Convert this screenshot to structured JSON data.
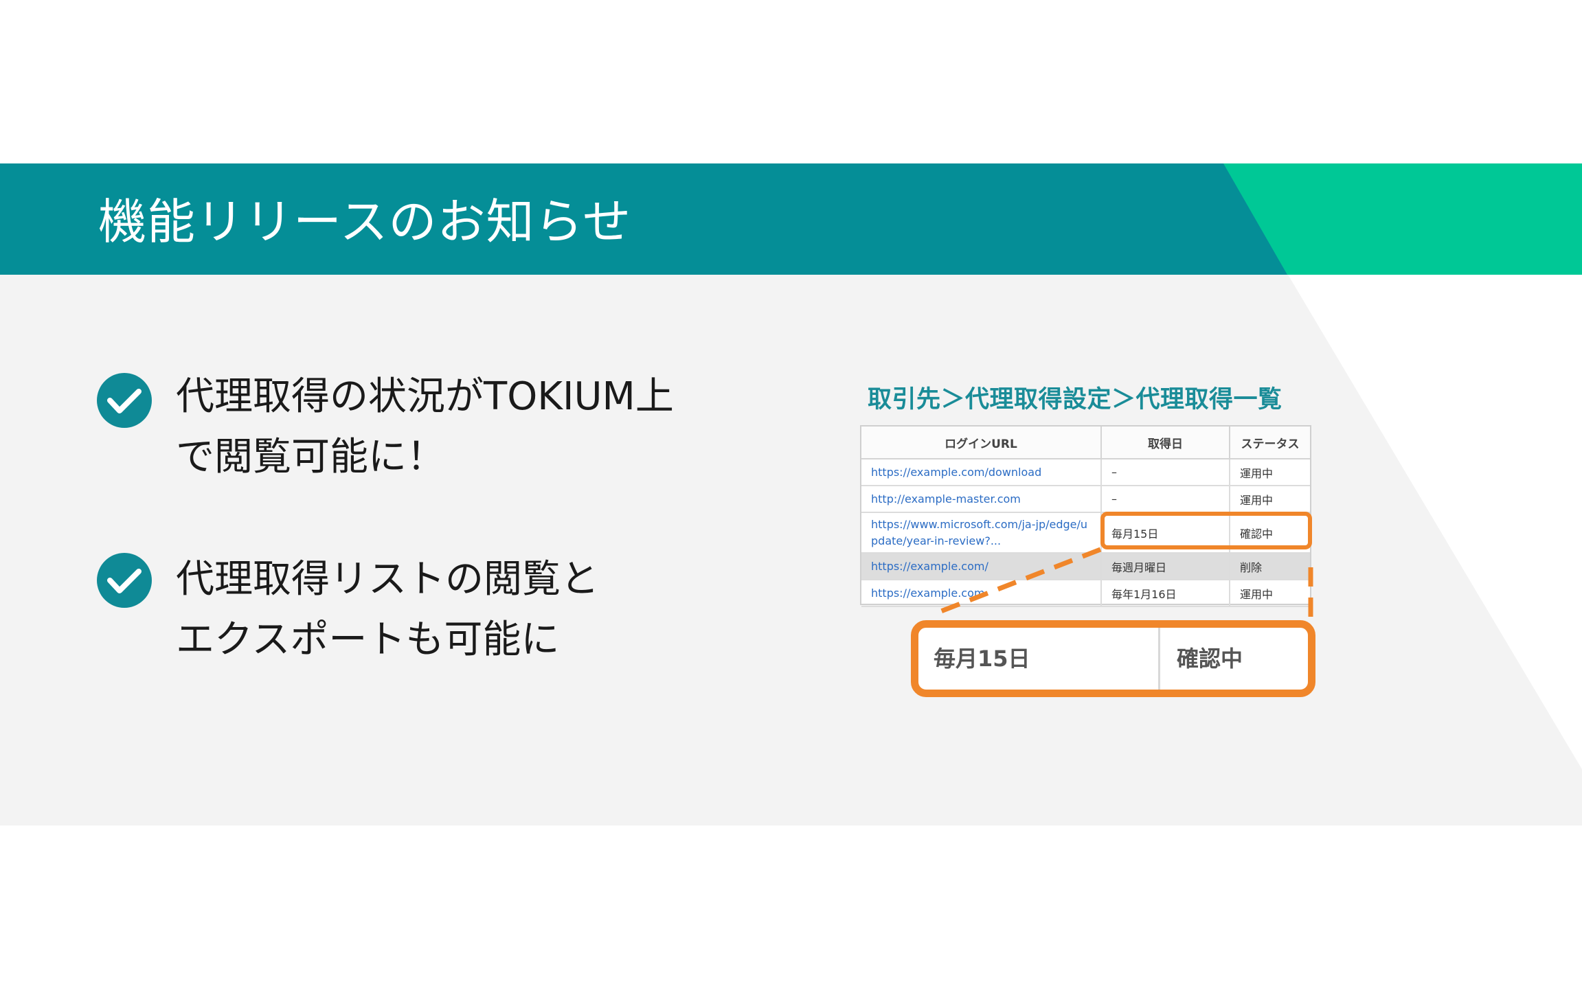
{
  "header": {
    "title": "機能リリースのお知らせ",
    "bg_color": "#058e97",
    "accent_color": "#00c896"
  },
  "bullets": [
    {
      "icon": "check-circle-icon",
      "line1": "代理取得の状況がTOKIUM上",
      "line2": "で閲覧可能に！"
    },
    {
      "icon": "check-circle-icon",
      "line1": "代理取得リストの閲覧と",
      "line2": "エクスポートも可能に"
    }
  ],
  "screenshot": {
    "breadcrumb": "取引先＞代理取得設定＞代理取得一覧",
    "columns": [
      "ログインURL",
      "取得日",
      "ステータス"
    ],
    "rows": [
      {
        "url": "https://example.com/download",
        "date": "–",
        "status": "運用中"
      },
      {
        "url": "http://example-master.com",
        "date": "–",
        "status": "運用中"
      },
      {
        "url": "https://www.microsoft.com/ja-jp/edge/update/year-in-review?...",
        "date": "毎月15日",
        "status": "確認中"
      },
      {
        "url": "https://example.com/",
        "date": "毎週月曜日",
        "status": "削除"
      },
      {
        "url": "https://example.com",
        "date": "毎年1月16日",
        "status": "運用中"
      }
    ],
    "highlight_color": "#f0862a",
    "zoom": {
      "date": "毎月15日",
      "status": "確認中"
    }
  }
}
